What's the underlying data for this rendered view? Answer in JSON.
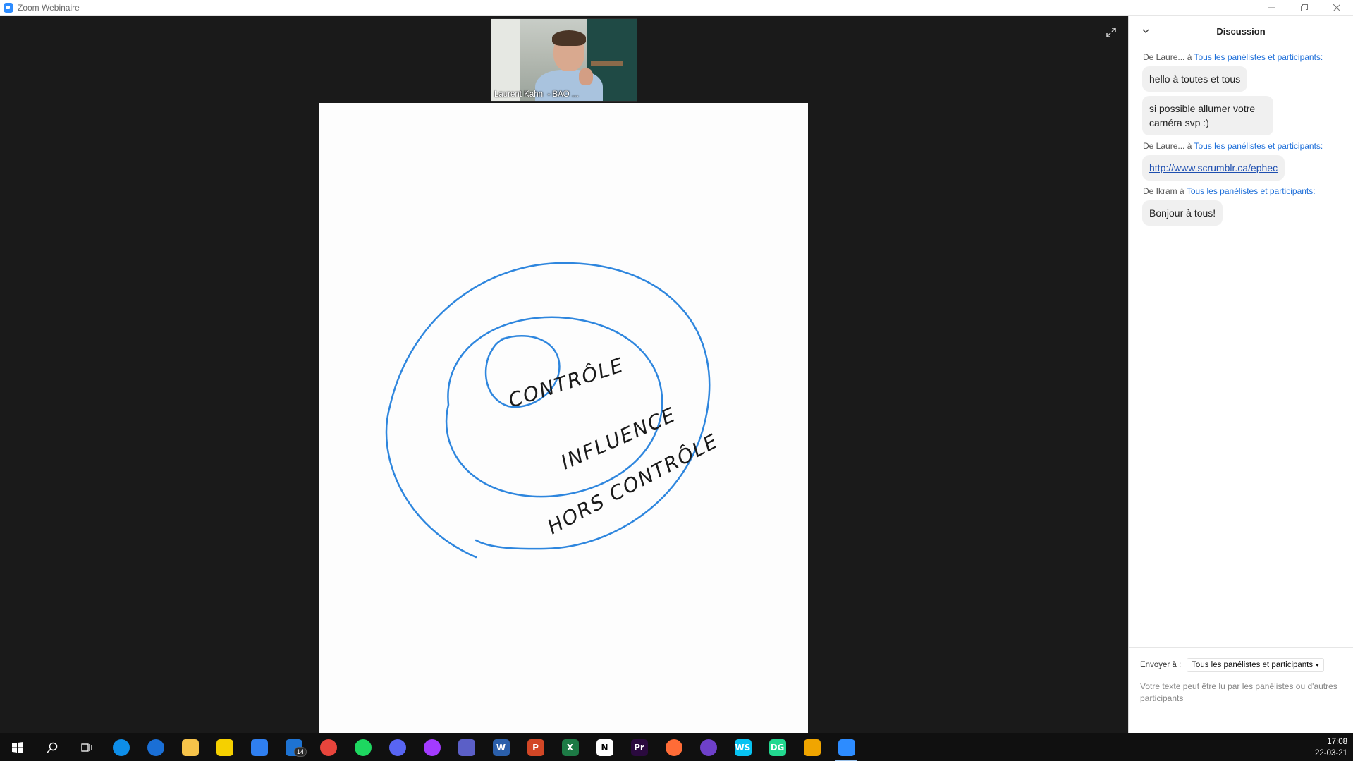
{
  "window": {
    "title": "Zoom Webinaire",
    "controls": [
      "minimize",
      "restore",
      "close"
    ]
  },
  "video": {
    "speaker_name": "Laurent Kahn  - BAO ..."
  },
  "slide": {
    "inner_label": "CONTRÔLE",
    "middle_label": "INFLUENCE",
    "outer_label": "HORS CONTRÔLE",
    "stroke_color": "#2e86de"
  },
  "chat": {
    "title": "Discussion",
    "messages": [
      {
        "from": "De Laure...",
        "sep": " à ",
        "to": "Tous les panélistes et participants:",
        "lines": [
          "hello à toutes et tous",
          "si possible allumer votre caméra svp :)"
        ]
      },
      {
        "from": "De Laure...",
        "sep": " à ",
        "to": "Tous les panélistes et participants:",
        "lines": [
          "http://www.scrumblr.ca/ephec"
        ]
      },
      {
        "from": "De Ikram",
        "sep": " à ",
        "to": "Tous les panélistes et participants:",
        "lines": [
          "Bonjour à tous!"
        ]
      }
    ],
    "send_to_label": "Envoyer à :",
    "send_to_value": "Tous les panélistes et participants",
    "compose_placeholder": "Votre texte peut être lu par les panélistes ou d'autres participants"
  },
  "taskbar": {
    "apps": [
      {
        "name": "start",
        "icon": "windows-icon",
        "color": "#ffffff"
      },
      {
        "name": "search",
        "icon": "search-icon",
        "color": "#ffffff"
      },
      {
        "name": "task-view",
        "icon": "task-view-icon",
        "color": "#ffffff"
      },
      {
        "name": "teamviewer",
        "icon": "teamviewer-icon",
        "color": "#0e8ee9"
      },
      {
        "name": "onedrive",
        "icon": "cloud-icon",
        "color": "#1a6fd6"
      },
      {
        "name": "file-explorer",
        "icon": "folder-icon",
        "color": "#f6c34a"
      },
      {
        "name": "sticky-notes",
        "icon": "note-icon",
        "color": "#f5d000"
      },
      {
        "name": "todo",
        "icon": "check-icon",
        "color": "#2f7ff0"
      },
      {
        "name": "mail",
        "icon": "mail-icon",
        "color": "#1e73d2",
        "badge": "14"
      },
      {
        "name": "chrome",
        "icon": "chrome-icon",
        "color": "#e8453c"
      },
      {
        "name": "spotify",
        "icon": "spotify-icon",
        "color": "#1ed760"
      },
      {
        "name": "discord",
        "icon": "discord-icon",
        "color": "#5865f2"
      },
      {
        "name": "messenger",
        "icon": "messenger-icon",
        "color": "#a33bff"
      },
      {
        "name": "teams",
        "icon": "teams-icon",
        "color": "#5b5fc7"
      },
      {
        "name": "word",
        "icon": "word-icon",
        "color": "#2b5faa",
        "letter": "W"
      },
      {
        "name": "powerpoint",
        "icon": "powerpoint-icon",
        "color": "#d24726",
        "letter": "P"
      },
      {
        "name": "excel",
        "icon": "excel-icon",
        "color": "#1d7a45",
        "letter": "X"
      },
      {
        "name": "notion",
        "icon": "notion-icon",
        "color": "#ffffff",
        "letter": "N"
      },
      {
        "name": "premiere",
        "icon": "premiere-icon",
        "color": "#2a0a3e",
        "letter": "Pr"
      },
      {
        "name": "postman",
        "icon": "postman-icon",
        "color": "#ff6c37"
      },
      {
        "name": "github",
        "icon": "github-icon",
        "color": "#6e40c9"
      },
      {
        "name": "webstorm",
        "icon": "webstorm-icon",
        "color": "#07c3f2",
        "letter": "WS"
      },
      {
        "name": "datagrip",
        "icon": "datagrip-icon",
        "color": "#22d88f",
        "letter": "DG"
      },
      {
        "name": "remote-desktop",
        "icon": "remote-desktop-icon",
        "color": "#f0a500"
      },
      {
        "name": "zoom",
        "icon": "zoom-icon",
        "color": "#2d8cff",
        "active": true
      }
    ],
    "time": "17:08",
    "date": "22-03-21"
  }
}
